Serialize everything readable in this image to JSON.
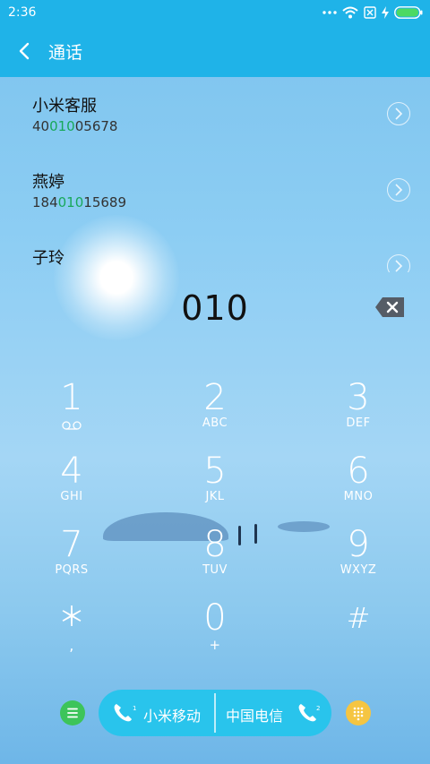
{
  "status": {
    "time": "2:36",
    "icons": [
      "more-dots-icon",
      "wifi-icon",
      "sim-off-icon",
      "charging-icon",
      "battery-icon"
    ]
  },
  "header": {
    "title": "通话"
  },
  "results": [
    {
      "name": "小米客服",
      "num_pre": "40",
      "num_hl": "010",
      "num_post": "05678"
    },
    {
      "name": "燕婷",
      "num_pre": "184",
      "num_hl": "010",
      "num_post": "15689"
    },
    {
      "name": "子玲",
      "num_pre": "",
      "num_hl": "",
      "num_post": ""
    }
  ],
  "display": {
    "value": "010"
  },
  "keypad": [
    {
      "digit": "1",
      "letters": ""
    },
    {
      "digit": "2",
      "letters": "ABC"
    },
    {
      "digit": "3",
      "letters": "DEF"
    },
    {
      "digit": "4",
      "letters": "GHI"
    },
    {
      "digit": "5",
      "letters": "JKL"
    },
    {
      "digit": "6",
      "letters": "MNO"
    },
    {
      "digit": "7",
      "letters": "PQRS"
    },
    {
      "digit": "8",
      "letters": "TUV"
    },
    {
      "digit": "9",
      "letters": "WXYZ"
    },
    {
      "digit": "＊",
      "letters": ","
    },
    {
      "digit": "0",
      "letters": "+"
    },
    {
      "digit": "#",
      "letters": ""
    }
  ],
  "callbar": {
    "sim1": "小米移动",
    "sim2": "中国电信",
    "sim1_badge": "1",
    "sim2_badge": "2"
  },
  "colors": {
    "accent": "#1fb3e8",
    "highlight": "#18a85a",
    "call_button": "#29c4ec",
    "menu_button": "#3dc45a",
    "dialpad_button": "#f5c542"
  }
}
